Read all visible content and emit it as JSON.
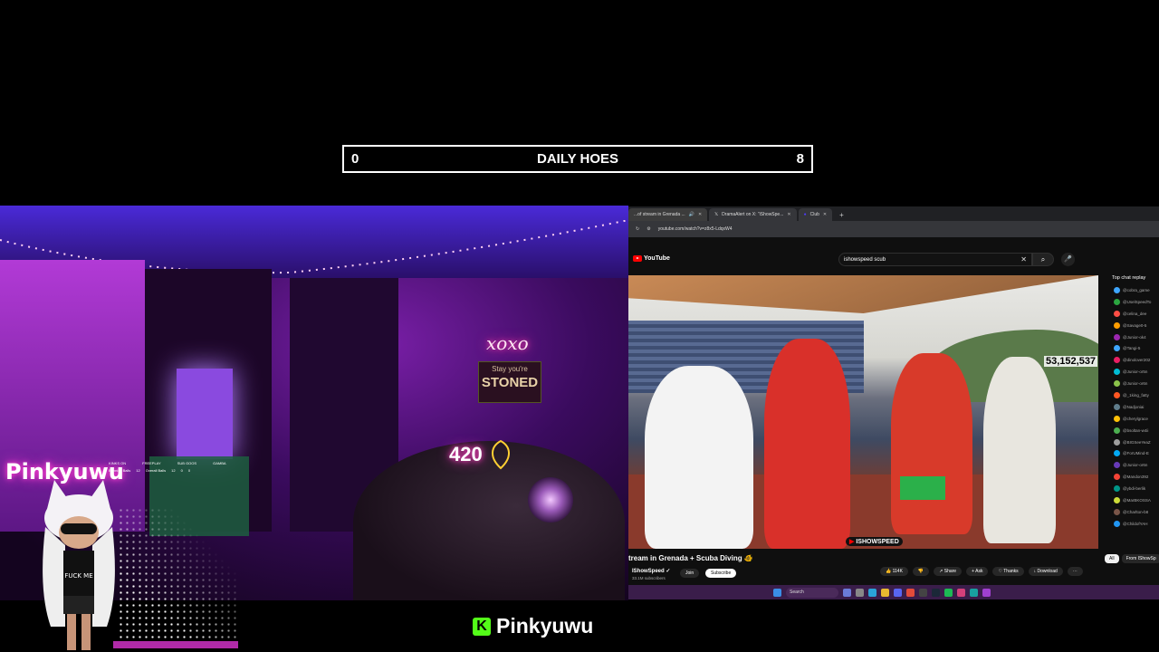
{
  "counter": {
    "left_value": "0",
    "title": "DAILY HOES",
    "right_value": "8"
  },
  "webcam": {
    "neon_xoxo": "xoxo",
    "stoned_sign_top": "Stay you're",
    "stoned_sign": "STONED",
    "neon_420": "420",
    "neon_left_sign": "Pinkyuwu",
    "overlay_card": {
      "headers": [
        "KINKS ON",
        "FREEPLAY",
        "SUB GOOS",
        "GAMBA"
      ],
      "row": [
        "Bunnies Balls",
        "12",
        "Overall Balls",
        "12",
        "0",
        "0"
      ]
    },
    "avatar_shirt": "FUCK ME"
  },
  "browser": {
    "tabs": [
      {
        "label": "...of stream in Grenada ...",
        "icon": "speaker-icon",
        "active": true
      },
      {
        "label": "DramaAlert on X: \"iShowSpe...",
        "icon": "x-logo-icon",
        "active": false
      },
      {
        "label": "Club",
        "icon": "club-icon",
        "active": false
      }
    ],
    "url": "youtube.com/watch?v=z8x5-LdqxW4",
    "youtube": {
      "logo": "YouTube",
      "search_value": "ishowspeed scub",
      "viewer_count": "53,152,537",
      "watermark": "ISHOWSPEED",
      "video_title": "tream in Grenada + Scuba Diving 🐠",
      "channel_name": "IShowSpeed ✓",
      "subscribers": "33.1M subscribers",
      "join_label": "Join",
      "subscribe_label": "Subscribe",
      "actions": [
        "👍 114K",
        "👎",
        "↗ Share",
        "+ Ask",
        "♡ Thanks",
        "↓ Download",
        "⋯"
      ],
      "chat_header": "Top chat replay",
      "chat_users": [
        "@cobra_game",
        "@UselSpeedTo",
        "@celina_dee",
        "@Savage0-5",
        "@Junior-ok4",
        "@Tangi-5",
        "@dinolover202",
        "@Junior-or5n",
        "@Junior-or6n",
        "@_1king_fatty",
        "@Nadjoniai",
        "@cherylgrace",
        "@bsoltan-w4ii",
        "@BIGSeeYeaZ",
        "@ForUMind-E",
        "@Junior-or6n",
        "@Mandon392",
        "@ybdi-berlik",
        "@MarBKOSSA",
        "@Charlton-b8",
        "@ChildofYAH"
      ],
      "chat_colors": [
        "#3ea6ff",
        "#2ba640",
        "#ff4e45",
        "#ff9d00",
        "#9c27b0",
        "#3ea6ff",
        "#e91e63",
        "#00bcd4",
        "#8bc34a",
        "#ff5722",
        "#607d8b",
        "#ffc107",
        "#4caf50",
        "#9e9e9e",
        "#03a9f4",
        "#673ab7",
        "#f44336",
        "#009688",
        "#cddc39",
        "#795548",
        "#2196f3"
      ],
      "chat_chips": [
        "All",
        "From IShowSp"
      ]
    },
    "taskbar": {
      "search_label": "Search"
    }
  },
  "brand": {
    "logo_letter": "K",
    "name": "Pinkyuwu",
    "accent": "#53fc18"
  }
}
